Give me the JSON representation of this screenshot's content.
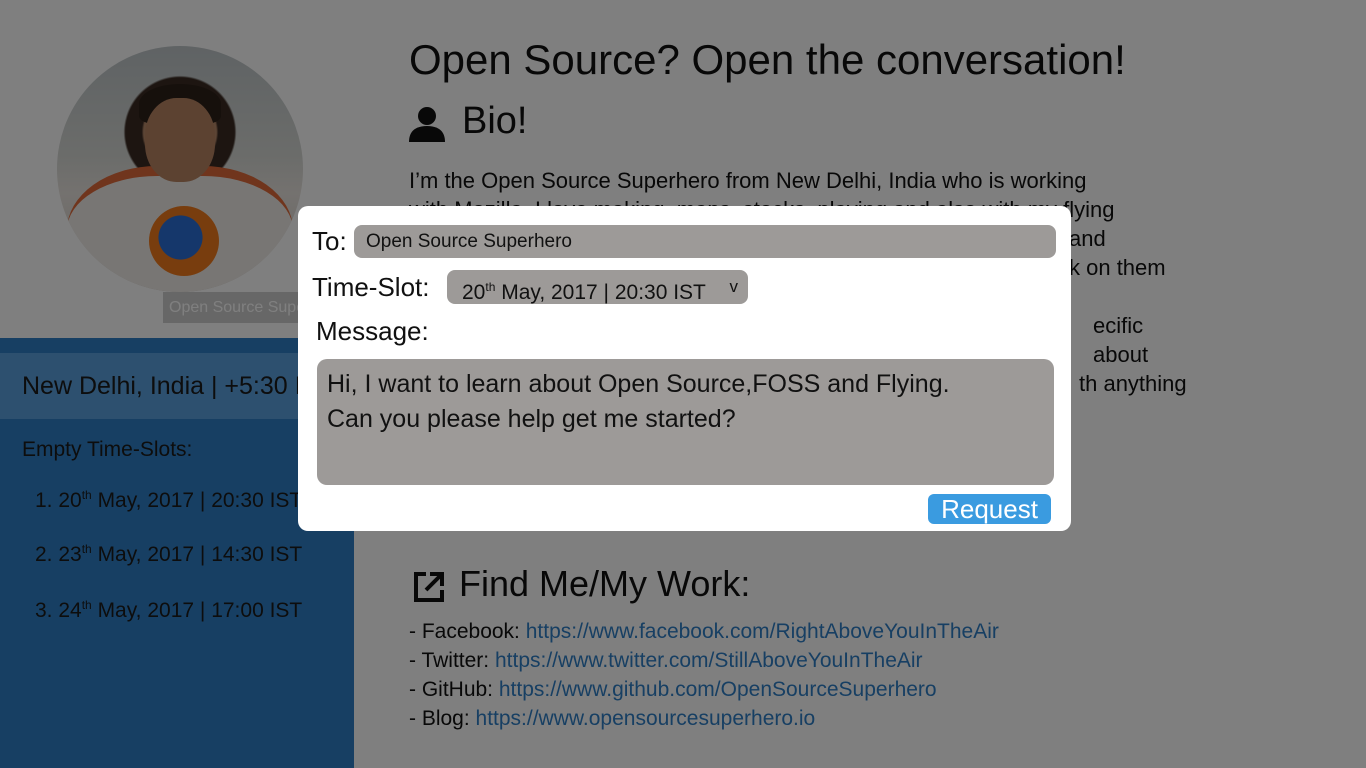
{
  "profile": {
    "name_tag": "Open Source Supe",
    "location": "New Delhi, India | +5:30 I",
    "slots_title": "Empty Time-Slots:",
    "slots": [
      {
        "num": "1. 20",
        "sup": "th",
        "rest": " May, 2017 | 20:30 IST"
      },
      {
        "num": "2. 23",
        "sup": "th",
        "rest": " May, 2017 | 14:30 IST"
      },
      {
        "num": "3. 24",
        "sup": "th",
        "rest": " May, 2017 | 17:00 IST"
      }
    ]
  },
  "main": {
    "title": "Open Source? Open the conversation!",
    "bio_title": "Bio!",
    "bio_text_1": "I’m the Open Source Superhero from New Delhi, India who is working",
    "bio_text_2": "with Mozilla. I love making, maps, stocks, playing and also with my flying",
    "bio_text_3": "and",
    "bio_text_4": "k on them",
    "bio_text_5": "ecific about",
    "bio_text_6": "th anything",
    "find_title": "Find Me/My Work:",
    "links": [
      {
        "label": "- Facebook: ",
        "url": "https://www.facebook.com/RightAboveYouInTheAir"
      },
      {
        "label": "- Twitter: ",
        "url": "https://www.twitter.com/StillAboveYouInTheAir"
      },
      {
        "label": "- GitHub: ",
        "url": "https://www.github.com/OpenSourceSuperhero"
      },
      {
        "label": "- Blog: ",
        "url": "https://www.opensourcesuperhero.io"
      }
    ]
  },
  "modal": {
    "to_label": "To:",
    "to_value": "Open Source Superhero",
    "slot_label": "Time-Slot:",
    "slot_num": "20",
    "slot_sup": "th",
    "slot_rest": " May, 2017 | 20:30 IST",
    "slot_chevron": "v",
    "message_label": "Message:",
    "message_line1": "Hi, I want to learn about Open Source,FOSS and Flying.",
    "message_line2": "Can you please help get me started?",
    "request_label": "Request"
  },
  "colors": {
    "accent": "#2f7fc6",
    "button": "#3a9be0",
    "field": "#9d9a98"
  }
}
